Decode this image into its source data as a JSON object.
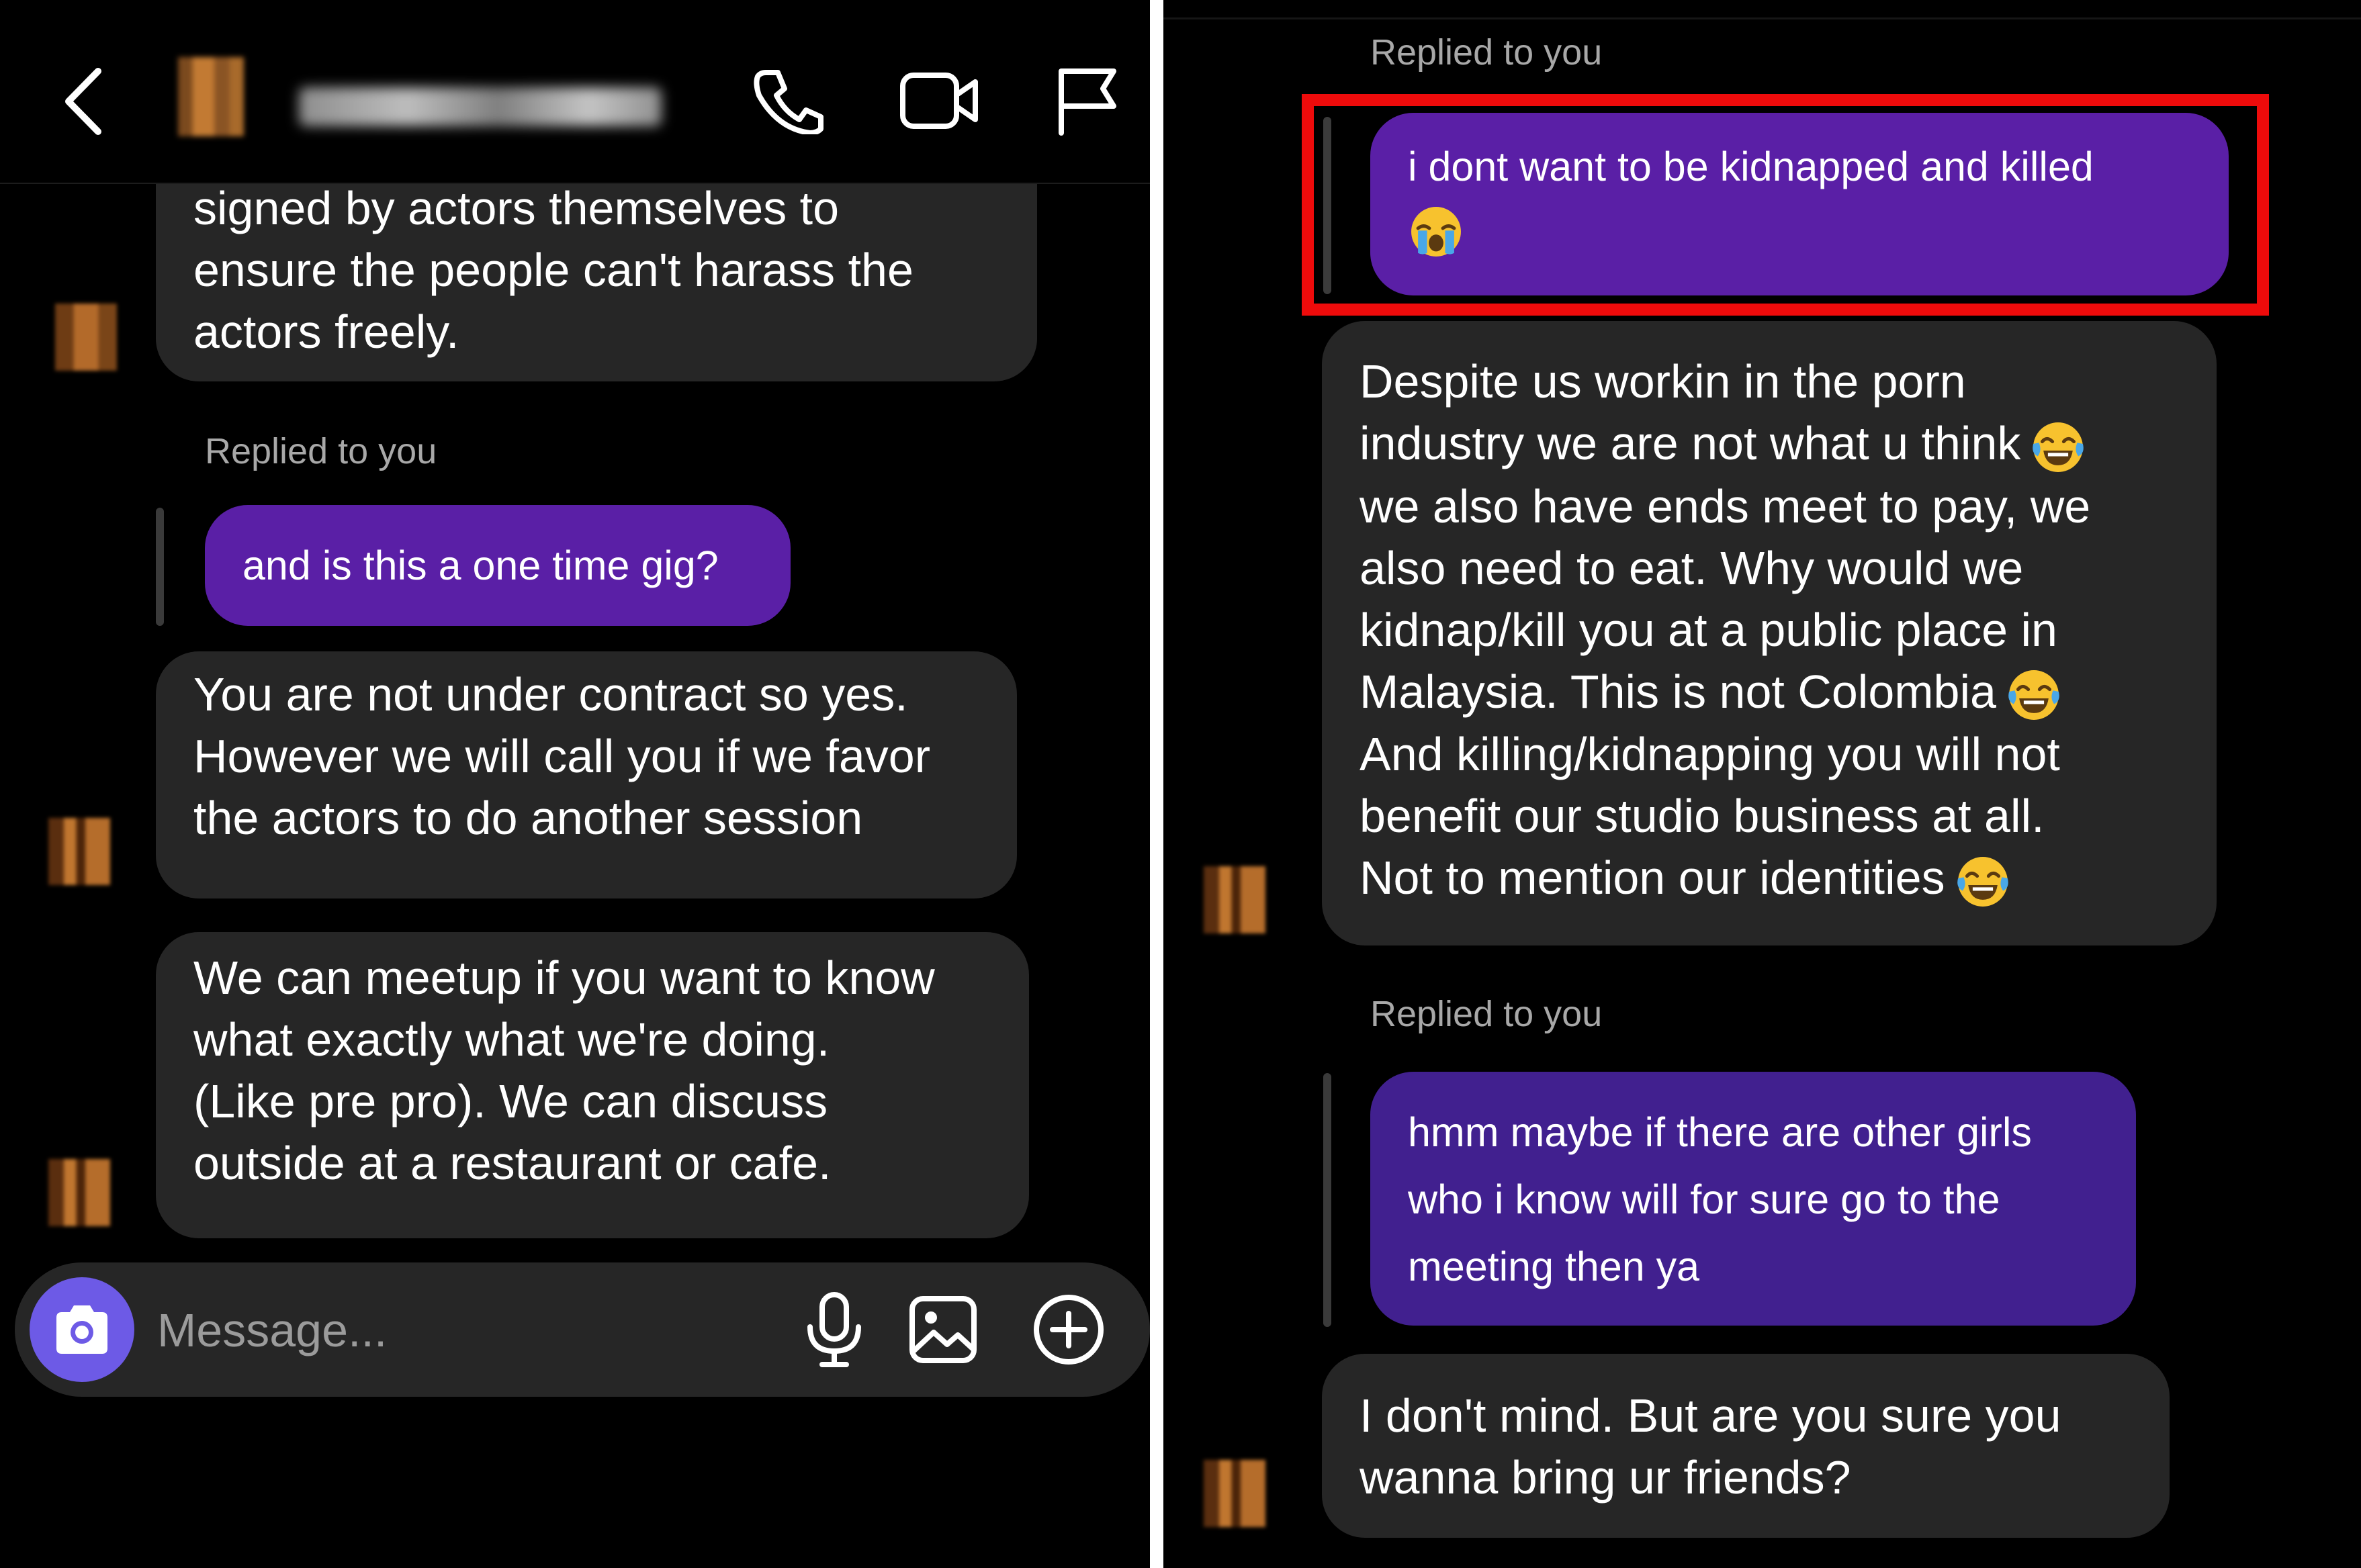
{
  "left_panel": {
    "header": {
      "back_icon": "chevron-left-icon",
      "call_icon": "phone-icon",
      "video_icon": "video-camera-icon",
      "report_icon": "flag-icon"
    },
    "messages": [
      {
        "type": "received",
        "lines": [
          "signed by actors themselves to",
          "ensure the people can't harass the",
          "actors freely."
        ]
      },
      {
        "type": "reply_label",
        "text": "Replied to you"
      },
      {
        "type": "sent",
        "lines": [
          "and is this a one time gig?"
        ]
      },
      {
        "type": "received",
        "lines": [
          "You are not under contract so yes.",
          "However we will call you if we favor",
          "the actors to do another session"
        ]
      },
      {
        "type": "received",
        "lines": [
          "We can meetup if you want to know",
          "what exactly what we're doing.",
          "(Like pre pro). We can discuss",
          "outside at a restaurant or cafe."
        ]
      }
    ],
    "composer": {
      "placeholder": "Message...",
      "camera_icon": "camera-icon",
      "mic_icon": "microphone-icon",
      "gallery_icon": "image-icon",
      "more_icon": "plus-circle-icon"
    }
  },
  "right_panel": {
    "messages": [
      {
        "type": "reply_label",
        "text": "Replied to you"
      },
      {
        "type": "sent",
        "highlighted": true,
        "lines": [
          "i dont want to be kidnapped and killed",
          ""
        ],
        "emoji": [
          "loudly-crying-face"
        ]
      },
      {
        "type": "received",
        "lines": [
          "Despite us workin in the porn",
          "industry we are not what u think",
          "we also have ends meet to pay, we",
          "also need to eat. Why would we",
          "kidnap/kill you at a public place in",
          "Malaysia. This is not Colombia",
          "And killing/kidnapping you will not",
          "benefit our studio business at all.",
          "Not to mention our identities"
        ],
        "emoji": [
          "tears-of-joy-face",
          "tears-of-joy-face",
          "tears-of-joy-face"
        ]
      },
      {
        "type": "reply_label",
        "text": "Replied to you"
      },
      {
        "type": "sent",
        "lines": [
          "hmm maybe if there are other girls",
          "who i know will for sure go to the",
          "meeting then ya"
        ]
      },
      {
        "type": "received",
        "lines": [
          "I don't mind. But are you sure you",
          "wanna bring ur friends?"
        ]
      }
    ]
  },
  "colors": {
    "background": "#000000",
    "received_bubble": "#262626",
    "sent_bubble": "#5a1fa6",
    "sent_bubble_alt": "#41208f",
    "highlight_border": "#ee0b0b",
    "camera_button": "#6d5ae6",
    "muted_text": "#a8a8a8"
  }
}
